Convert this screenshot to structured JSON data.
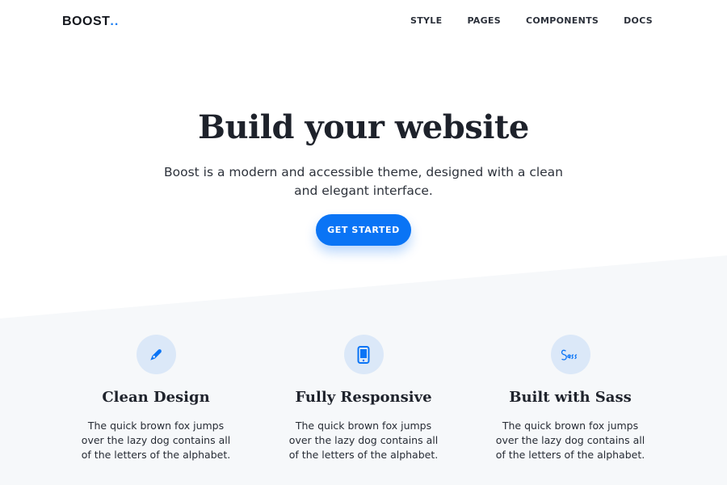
{
  "brand": {
    "name": "BOOST",
    "dots": "..",
    "accent": "#1a7ef2"
  },
  "nav": {
    "items": [
      "STYLE",
      "PAGES",
      "COMPONENTS",
      "DOCS"
    ]
  },
  "hero": {
    "title": "Build your website",
    "subtitle": "Boost is a modern and accessible theme, designed with a clean and elegant interface.",
    "cta_label": "GET STARTED"
  },
  "features": [
    {
      "icon": "pen-icon",
      "title": "Clean Design",
      "text": "The quick brown fox jumps over the lazy dog contains all of the letters of the alphabet."
    },
    {
      "icon": "mobile-icon",
      "title": "Fully Responsive",
      "text": "The quick brown fox jumps over the lazy dog contains all of the letters of the alphabet."
    },
    {
      "icon": "sass-icon",
      "title": "Built with Sass",
      "text": "The quick brown fox jumps over the lazy dog contains all of the letters of the alphabet."
    }
  ],
  "colors": {
    "primary": "#0a74f5",
    "section_bg": "#f6f8fa",
    "icon_bg": "#dbe8f8"
  }
}
